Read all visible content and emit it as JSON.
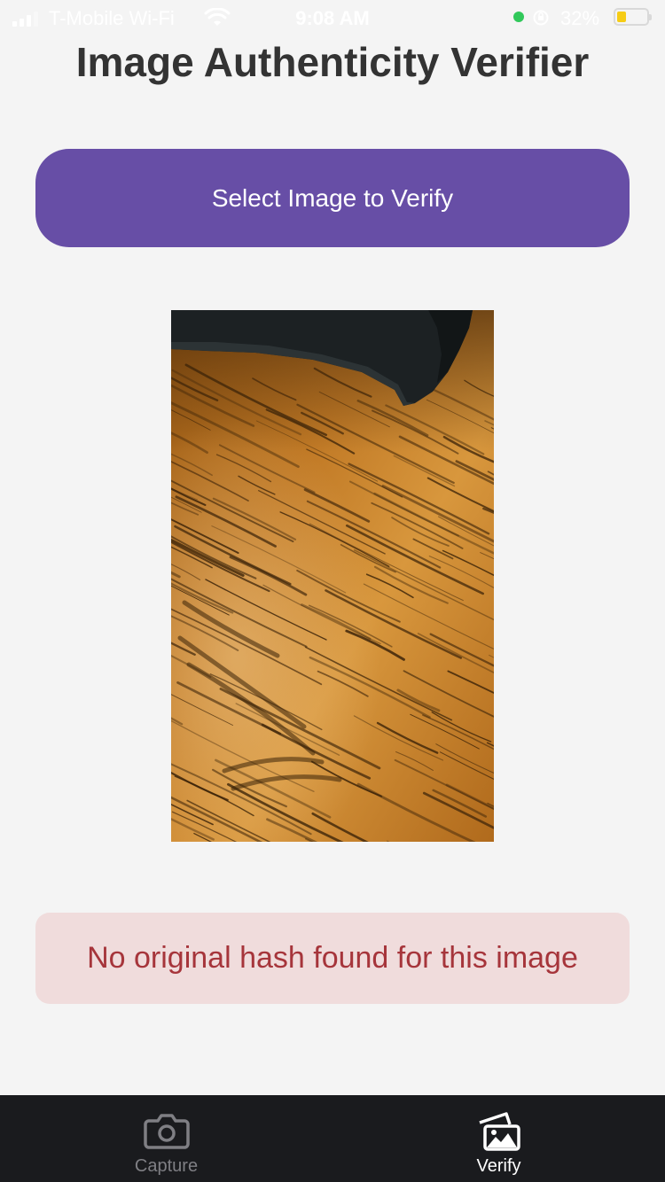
{
  "status_bar": {
    "carrier": "T-Mobile Wi-Fi",
    "time": "9:08 AM",
    "battery_percent": "32%",
    "battery_level": 0.32,
    "icons": [
      "signal-icon",
      "wifi-icon",
      "camera-in-use-dot",
      "orientation-lock-icon",
      "battery-icon"
    ]
  },
  "header": {
    "title": "Image Authenticity Verifier"
  },
  "main": {
    "select_button_label": "Select Image to Verify",
    "preview_image_icon": "wood-grain-photo",
    "result_message": "No original hash found for this image"
  },
  "tab_bar": {
    "tabs": [
      {
        "label": "Capture",
        "icon": "camera-icon",
        "active": false
      },
      {
        "label": "Verify",
        "icon": "images-icon",
        "active": true
      }
    ]
  },
  "colors": {
    "background": "#f4f4f4",
    "button": "#674ea6",
    "error_background": "#f0dcdc",
    "error_text": "#a6353b",
    "tab_bar": "#1a1b1e"
  }
}
